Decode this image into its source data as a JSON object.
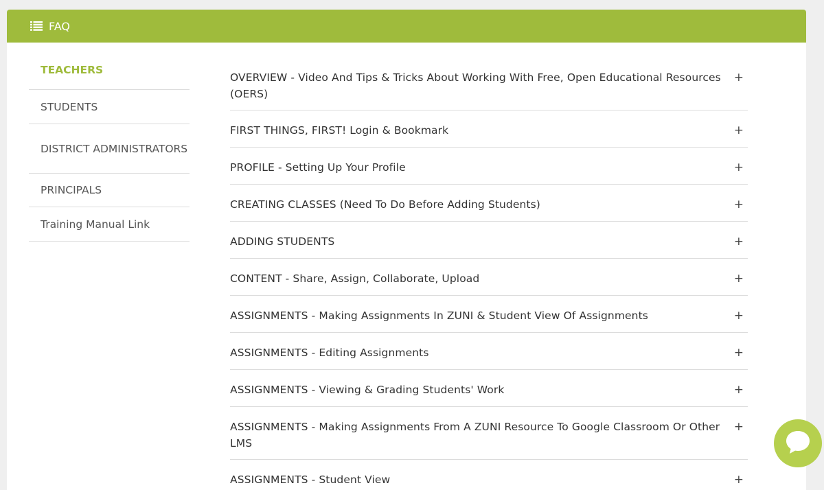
{
  "header": {
    "title": "FAQ",
    "icon": "list-icon"
  },
  "sidebar": {
    "items": [
      {
        "label": "TEACHERS",
        "active": true
      },
      {
        "label": "STUDENTS"
      },
      {
        "label": "DISTRICT ADMINISTRATORS"
      },
      {
        "label": "PRINCIPALS"
      },
      {
        "label": "Training Manual Link"
      }
    ]
  },
  "faq": {
    "items": [
      {
        "label": "OVERVIEW - Video And Tips & Tricks About Working With Free, Open Educational Resources (OERS)",
        "toggle": "+"
      },
      {
        "label": "FIRST THINGS, FIRST! Login & Bookmark",
        "toggle": "+"
      },
      {
        "label": "PROFILE - Setting Up Your Profile",
        "toggle": "+"
      },
      {
        "label": "CREATING CLASSES (Need To Do Before Adding Students)",
        "toggle": "+"
      },
      {
        "label": "ADDING STUDENTS",
        "toggle": "+"
      },
      {
        "label": "CONTENT - Share, Assign, Collaborate, Upload",
        "toggle": "+"
      },
      {
        "label": "ASSIGNMENTS - Making Assignments In ZUNI & Student View Of Assignments",
        "toggle": "+"
      },
      {
        "label": "ASSIGNMENTS - Editing Assignments",
        "toggle": "+"
      },
      {
        "label": "ASSIGNMENTS - Viewing & Grading Students' Work",
        "toggle": "+"
      },
      {
        "label": "ASSIGNMENTS - Making Assignments From A ZUNI Resource To Google Classroom Or Other LMS",
        "toggle": "+"
      },
      {
        "label": "ASSIGNMENTS - Student View",
        "toggle": "+"
      }
    ]
  },
  "chat": {
    "icon": "chat-icon"
  },
  "colors": {
    "accent": "#9fbb3c",
    "chat": "#b6d04e",
    "background": "#efefef"
  }
}
